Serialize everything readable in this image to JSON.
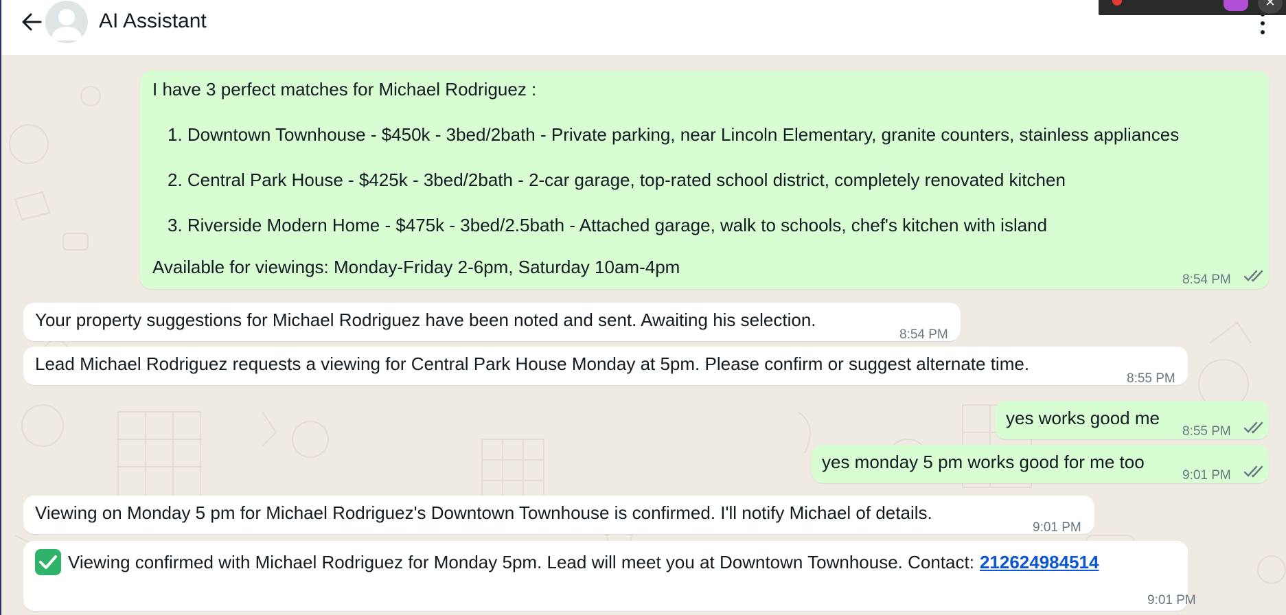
{
  "header": {
    "title": "AI Assistant",
    "back_icon": "arrow-left-icon",
    "avatar_icon": "default-avatar-icon",
    "menu_icon": "more-vertical-icon"
  },
  "colors": {
    "chat_background": "#efeae2",
    "outgoing_bubble": "#d9fdd3",
    "incoming_bubble": "#ffffff",
    "read_tick": "#667781",
    "link": "#0b57d0"
  },
  "messages": [
    {
      "direction": "outgoing",
      "intro": "I have 3 perfect matches for Michael Rodriguez :",
      "items": [
        "1. Downtown Townhouse - $450k - 3bed/2bath - Private parking, near Lincoln Elementary, granite counters, stainless appliances",
        "2. Central Park House - $425k - 3bed/2bath - 2-car garage, top-rated school district, completely renovated kitchen",
        "3. Riverside Modern Home - $475k - 3bed/2.5bath - Attached garage, walk to schools, chef's kitchen with island"
      ],
      "footer": "Available for viewings: Monday-Friday 2-6pm, Saturday 10am-4pm",
      "time": "8:54 PM",
      "status": "read"
    },
    {
      "direction": "incoming",
      "text": "Your property suggestions for Michael Rodriguez have been noted and sent. Awaiting his selection.",
      "time": "8:54 PM"
    },
    {
      "direction": "incoming",
      "text": "Lead Michael Rodriguez requests a viewing for Central Park House Monday at 5pm. Please confirm or suggest alternate time.",
      "time": "8:55 PM"
    },
    {
      "direction": "outgoing",
      "text": "yes works good me",
      "time": "8:55 PM",
      "status": "read"
    },
    {
      "direction": "outgoing",
      "text": "yes monday 5 pm works good for me too",
      "time": "9:01 PM",
      "status": "read"
    },
    {
      "direction": "incoming",
      "text": "Viewing on Monday 5 pm for Michael Rodriguez's Downtown Townhouse is confirmed. I'll notify Michael of details.",
      "time": "9:01 PM"
    },
    {
      "direction": "incoming",
      "emoji": "check-mark-button-icon",
      "text": "Viewing confirmed with Michael Rodriguez for Monday 5pm. Lead will meet you at Downtown Townhouse. Contact:",
      "phone": "212624984514",
      "time": "9:01 PM"
    }
  ]
}
